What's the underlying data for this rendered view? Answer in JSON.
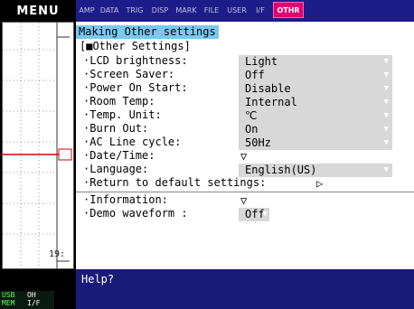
{
  "left": {
    "menu_label": "MENU",
    "div_value": "19:",
    "status": {
      "usb": "USB",
      "io": "OH",
      "mem": "MEM",
      "if": "I/F"
    }
  },
  "tabs": [
    "AMP",
    "DATA",
    "TRIG",
    "DISP",
    "MARK",
    "FILE",
    "USER",
    "I/F",
    "OTHR"
  ],
  "active_tab": "OTHR",
  "panel": {
    "title": "Making Other settings",
    "section": "[■Other Settings]",
    "rows": [
      {
        "label": "·LCD brightness:",
        "value": "Light"
      },
      {
        "label": "·Screen Saver:",
        "value": "Off"
      },
      {
        "label": "·Power On Start:",
        "value": "Disable"
      },
      {
        "label": "·Room Temp:",
        "value": "Internal"
      },
      {
        "label": "·Temp. Unit:",
        "value": "℃"
      },
      {
        "label": "·Burn Out:",
        "value": "On"
      },
      {
        "label": "·AC Line cycle:",
        "value": "50Hz"
      },
      {
        "label": "·Date/Time:",
        "value": "▽"
      },
      {
        "label": "·Language:",
        "value": "English(US)"
      },
      {
        "label": "·Return to default settings:",
        "value": "▷"
      },
      {
        "label": "·Information:",
        "value": "▽"
      },
      {
        "label": "·Demo waveform :",
        "value": "Off"
      }
    ]
  },
  "help": {
    "text": "Help?"
  },
  "colors": {
    "tabbar": "#1d1d8a",
    "active_tab": "#e00070",
    "title_highlight": "#7ac8f0",
    "help_bar": "#1a1a78",
    "waveform": "#e00000"
  }
}
